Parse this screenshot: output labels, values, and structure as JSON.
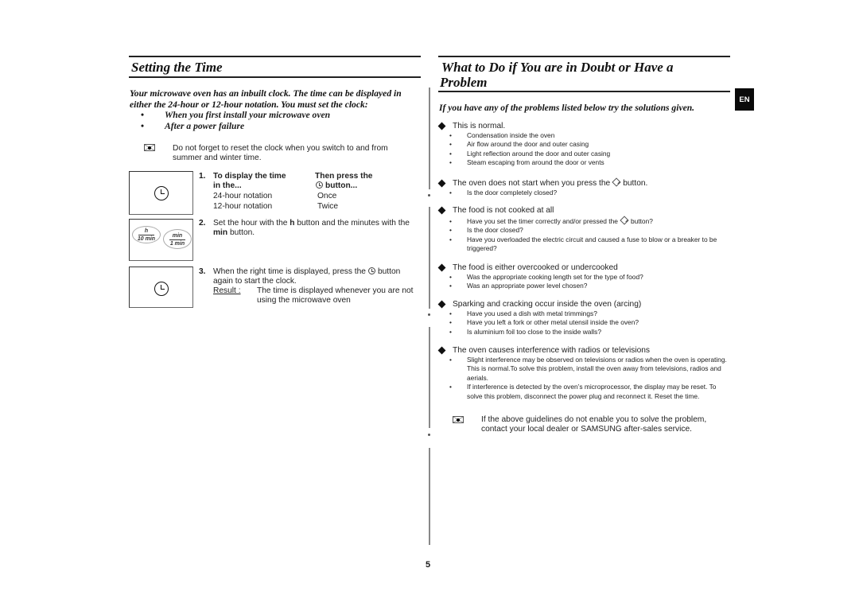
{
  "left": {
    "title": "Setting the Time",
    "intro": "Your microwave oven has an inbuilt clock. The time can be displayed in either the 24-hour or 12-hour notation. You must set the clock:",
    "intro_bullets": [
      "When you first install your microwave oven",
      "After a power failure"
    ],
    "note": "Do not forget to reset the clock when you switch to and from summer and winter time.",
    "step1": {
      "number": "1.",
      "col1_header_line1": "To display the time",
      "col1_header_line2": "in the...",
      "col2_header_line1": "Then press the",
      "col2_header_line2": "button...",
      "rows": [
        {
          "notation": "24-hour notation",
          "presses": "Once"
        },
        {
          "notation": "12-hour notation",
          "presses": "Twice"
        }
      ]
    },
    "step2": {
      "number": "2.",
      "text_part1": "Set the hour with the ",
      "bold1": "h",
      "text_part2": " button and the minutes with the ",
      "bold2": "min",
      "text_part3": " button.",
      "oval_h": {
        "top": "h",
        "bottom": "10 min"
      },
      "oval_min": {
        "top": "min",
        "bottom": "1 min"
      }
    },
    "step3": {
      "number": "3.",
      "text_part1": "When the right time is displayed, press the",
      "text_part2": "button again to start the clock.",
      "result_label": "Result :",
      "result_text": "The time is displayed whenever you are not using the microwave oven"
    }
  },
  "right": {
    "title_line1": "What to Do if You are in Doubt or Have a",
    "title_line2": "Problem",
    "intro": "If you have any of the problems listed below try the solutions given.",
    "language_tab": "EN",
    "problems": [
      {
        "heading": "This is normal.",
        "items": [
          "Condensation inside the oven",
          "Air flow around the door and outer casing",
          "Light reflection around the door and outer casing",
          "Steam escaping from around the door or vents"
        ]
      },
      {
        "heading_part1": "The oven does not start when you press the",
        "heading_part2": "button.",
        "items": [
          "Is the door completely closed?"
        ]
      },
      {
        "heading": "The food is not cooked at all",
        "item0_part1": "Have you set the timer correctly and/or pressed the",
        "item0_part2": "button?",
        "items": [
          "Is the door closed?",
          "Have you overloaded the electric circuit and caused a fuse to blow or a breaker to be triggered?"
        ]
      },
      {
        "heading": "The food is either overcooked or undercooked",
        "items": [
          "Was the appropriate cooking length set for the type of food?",
          "Was an appropriate power level chosen?"
        ]
      },
      {
        "heading": "Sparking and cracking occur inside the oven (arcing)",
        "items": [
          "Have you used a dish with metal trimmings?",
          "Have you left a fork or other metal utensil inside the oven?",
          "Is aluminium foil too close to the inside walls?"
        ]
      },
      {
        "heading": "The oven causes interference with radios or televisions",
        "items": [
          "Slight interference may be observed on televisions or radios when the oven is operating. This is normal.To solve this problem, install the oven away from televisions, radios and aerials.",
          "If interference is detected by the oven’s microprocessor, the display may be reset. To solve this problem, disconnect the power plug and reconnect it. Reset the time."
        ]
      }
    ],
    "note": "If the above guidelines do not enable you to solve the problem, contact your local dealer or SAMSUNG after-sales service."
  },
  "footer": {
    "page_number": "5"
  }
}
